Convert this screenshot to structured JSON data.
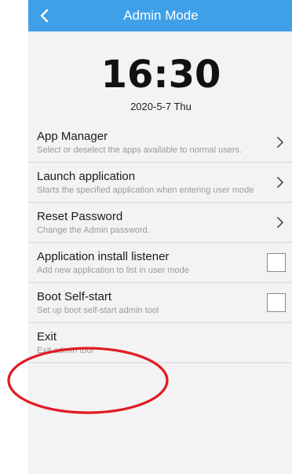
{
  "appbar": {
    "title": "Admin Mode",
    "back_icon": "chevron-left-icon"
  },
  "clock": {
    "time": "16:30",
    "date": "2020-5-7 Thu"
  },
  "settings": [
    {
      "key": "app_manager",
      "title": "App Manager",
      "subtitle": "Select or deselect the apps available to normal users.",
      "control": "chevron",
      "checked": null
    },
    {
      "key": "launch_application",
      "title": "Launch application",
      "subtitle": "Starts the specified application when entering user mode",
      "control": "chevron",
      "checked": null
    },
    {
      "key": "reset_password",
      "title": "Reset Password",
      "subtitle": "Change the Admin password.",
      "control": "chevron",
      "checked": null
    },
    {
      "key": "install_listener",
      "title": "Application install listener",
      "subtitle": "Add new application to list in user mode",
      "control": "checkbox",
      "checked": false
    },
    {
      "key": "boot_self_start",
      "title": "Boot Self-start",
      "subtitle": "Set up boot self-start admin tool",
      "control": "checkbox",
      "checked": false
    },
    {
      "key": "exit",
      "title": "Exit",
      "subtitle": "Exit admin tool",
      "control": "none",
      "checked": null
    }
  ],
  "colors": {
    "appbar": "#3fa0e8",
    "background": "#f3f3f3",
    "annotation": "#e01b24"
  },
  "annotation": {
    "shape": "ellipse",
    "highlighted_item": "exit"
  }
}
